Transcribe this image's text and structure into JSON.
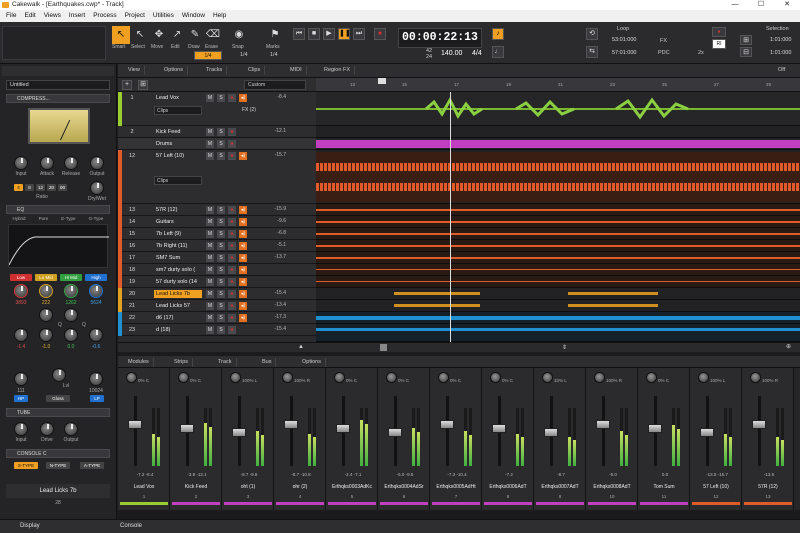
{
  "window": {
    "title": "Cakewalk - [Earthquakes.cwp* - Track]",
    "min": "—",
    "max": "☐",
    "close": "✕"
  },
  "menu": [
    "File",
    "Edit",
    "Views",
    "Insert",
    "Process",
    "Project",
    "Utilities",
    "Window",
    "Help"
  ],
  "tools": [
    {
      "label": "Smart"
    },
    {
      "label": "Select"
    },
    {
      "label": "Move"
    },
    {
      "label": "Edit"
    },
    {
      "label": "Draw"
    },
    {
      "label": "Erase"
    },
    {
      "label": "Snap"
    },
    {
      "label": "Marks"
    }
  ],
  "snap": {
    "value": "1/4",
    "marks": "1/4"
  },
  "transport": {
    "clock": "00:00:22:13",
    "meter_top": "42",
    "meter_bottom": "24",
    "tempo": "140.00",
    "timesig": "4/4"
  },
  "loop": {
    "label": "Loop",
    "start": "53:01:000",
    "end": "57:01:000"
  },
  "selection": {
    "label": "Selection",
    "start": "1:01:000",
    "end": "1:01:000"
  },
  "fx": {
    "fx": "FX",
    "pdc": "PDC",
    "ri": "RI",
    "twox": "2x"
  },
  "inspector": {
    "track_name": "Untitled",
    "compressor": "COMPRESS...",
    "comp_knobs": [
      "Input",
      "Attack",
      "Release",
      "Output"
    ],
    "ratio": "Ratio",
    "drywet": "Dry/Wet",
    "ratios": [
      "4",
      "8",
      "12",
      "20",
      "00"
    ],
    "eq": "EQ",
    "eq_modes": [
      "Hybrid",
      "Pure",
      "E-Type",
      "G-Type"
    ],
    "bands": [
      "Low",
      "Lo Mid",
      "Hi Mid",
      "High"
    ],
    "band_freqs": [
      "3893",
      "222",
      "1262",
      "5624"
    ],
    "band_q": [
      "Q",
      "Q"
    ],
    "gains": [
      "-1.4",
      "-1.0",
      "0.0",
      "-0.6"
    ],
    "lvl": "Lvl",
    "hp": "HP",
    "lp": "LP",
    "hp_val": "111",
    "lp_val": "10024",
    "gloss": "Gloss",
    "tube": "TUBE",
    "tube_knobs": [
      "Input",
      "Drive",
      "Output"
    ],
    "console": "CONSOLE C",
    "types": [
      "S-TYPE",
      "N-TYPE",
      "A-TYPE"
    ],
    "strip_name": "Lead Licks 7b",
    "strip_num": "28"
  },
  "trackview": {
    "tabs": [
      "View",
      "Options",
      "Tracks",
      "Clips",
      "MIDI",
      "Region FX"
    ],
    "dropdown": "Custom",
    "off": "Off"
  },
  "ruler": [
    "13",
    "15",
    "17",
    "19",
    "21",
    "23",
    "25",
    "27",
    "29"
  ],
  "tracks": [
    {
      "num": "1",
      "name": "Lead Vox",
      "vol": "-8.4",
      "color": "#9acd32",
      "sel": false
    },
    {
      "num": "2",
      "name": "Kick Feed",
      "vol": "-12.1",
      "color": "#555",
      "sel": false
    },
    {
      "num": "",
      "name": "Drums",
      "vol": "",
      "color": "#c040c0",
      "sel": false
    },
    {
      "num": "12",
      "name": "57 Left (10)",
      "vol": "-15.7",
      "color": "#e05a2a",
      "sel": false
    },
    {
      "num": "13",
      "name": "57R (12)",
      "vol": "-15.9",
      "color": "#e05a2a",
      "sel": false
    },
    {
      "num": "14",
      "name": "Guitars",
      "vol": "-9.6",
      "color": "#e05a2a",
      "sel": false
    },
    {
      "num": "15",
      "name": "7b Left (9)",
      "vol": "-6.8",
      "color": "#e05a2a",
      "sel": false
    },
    {
      "num": "16",
      "name": "7b Right (11)",
      "vol": "-5.1",
      "color": "#e05a2a",
      "sel": false
    },
    {
      "num": "17",
      "name": "SM7 Sum",
      "vol": "-13.7",
      "color": "#e05a2a",
      "sel": false
    },
    {
      "num": "18",
      "name": "sm7 durty solo (",
      "vol": "",
      "color": "#e05a2a",
      "sel": false
    },
    {
      "num": "19",
      "name": "57 durty solo (14",
      "vol": "",
      "color": "#e05a2a",
      "sel": false
    },
    {
      "num": "20",
      "name": "Lead Licks 7b",
      "vol": "-15.4",
      "color": "#e0a020",
      "sel": true
    },
    {
      "num": "21",
      "name": "Lead Licks 57",
      "vol": "-13.4",
      "color": "#e0a020",
      "sel": false
    },
    {
      "num": "22",
      "name": "d6 (17)",
      "vol": "-17.3",
      "color": "#2090d0",
      "sel": false
    },
    {
      "num": "23",
      "name": "d (18)",
      "vol": "-15.4",
      "color": "#2090d0",
      "sel": false
    }
  ],
  "lead_vox_extra": {
    "clips": "Clips",
    "fx": "FX (2)"
  },
  "console": {
    "tabs": [
      "Modules",
      "Strips",
      "Track",
      "Bus",
      "Options"
    ],
    "strips": [
      {
        "pan": "0% C",
        "vals": "-7.2  -8.4",
        "name": "Lead Vox",
        "num": "1",
        "color": "#9acd32"
      },
      {
        "pan": "0% C",
        "vals": "-3.9  -12.1",
        "name": "Kick Feed",
        "num": "2",
        "color": "#c040c0"
      },
      {
        "pan": "100% L",
        "vals": "-8.7  -9.6",
        "name": "oht (1)",
        "num": "3",
        "color": "#c040c0"
      },
      {
        "pan": "100% R",
        "vals": "-8.7  -10.8",
        "name": "ohr (2)",
        "num": "4",
        "color": "#c040c0"
      },
      {
        "pan": "0% C",
        "vals": "-2.4  -7.1",
        "name": "Erthqks0003AdKc",
        "num": "5",
        "color": "#c040c0"
      },
      {
        "pan": "0% C",
        "vals": "-5.0  -9.5",
        "name": "Erthqks0004AdSr",
        "num": "6",
        "color": "#c040c0"
      },
      {
        "pan": "0% C",
        "vals": "-7.3  -10.4",
        "name": "Erthqks0005AdHt",
        "num": "7",
        "color": "#c040c0"
      },
      {
        "pan": "0% C",
        "vals": "-7.2",
        "name": "Erthqks0006AdT",
        "num": "8",
        "color": "#c040c0"
      },
      {
        "pan": "33% L",
        "vals": "-8.7",
        "name": "Erthqks0007AdT",
        "num": "9",
        "color": "#c040c0"
      },
      {
        "pan": "100% R",
        "vals": "-5.0",
        "name": "Erthqks0008AdT",
        "num": "10",
        "color": "#c040c0"
      },
      {
        "pan": "0% C",
        "vals": "0.0",
        "name": "Tom Sum",
        "num": "11",
        "color": "#c040c0"
      },
      {
        "pan": "100% L",
        "vals": "-13.5  -15.7",
        "name": "57 Left (10)",
        "num": "12",
        "color": "#e05a2a"
      },
      {
        "pan": "100% R",
        "vals": "-13.5",
        "name": "57R (12)",
        "num": "13",
        "color": "#e05a2a"
      }
    ]
  },
  "bottom": {
    "display": "Display",
    "console": "Console"
  }
}
